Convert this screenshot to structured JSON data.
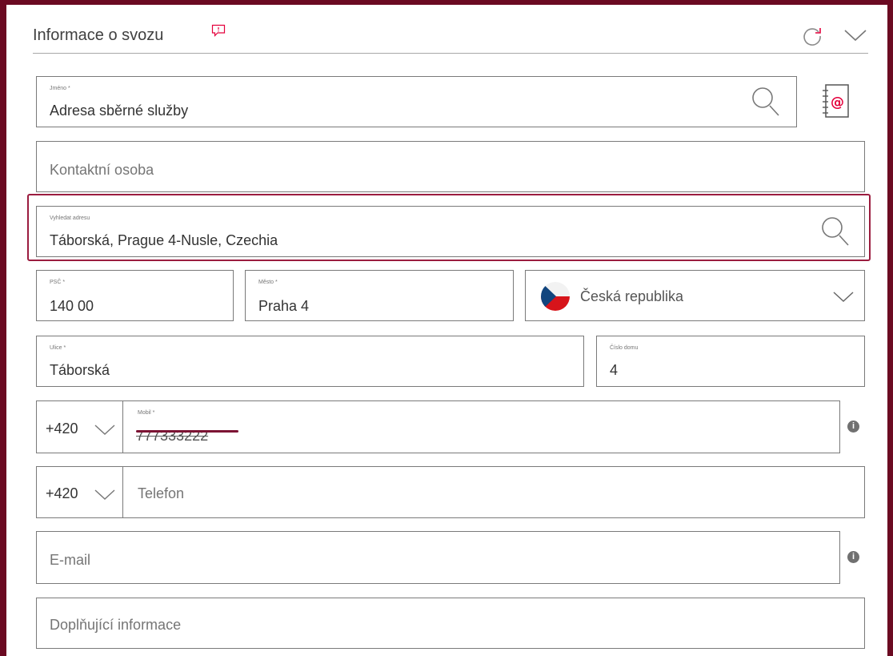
{
  "section": {
    "title": "Informace o svozu"
  },
  "icons": {
    "comment": "speech-bubble-icon",
    "refresh": "refresh-icon",
    "collapse": "chevron-down-icon",
    "search": "search-icon",
    "address_book": "address-book-icon",
    "flag": "czech-flag-icon",
    "info": "info-icon"
  },
  "fields": {
    "name": {
      "label": "Jméno *",
      "value": "Adresa sběrné služby"
    },
    "contact_person": {
      "placeholder": "Kontaktní osoba"
    },
    "address_search": {
      "label": "Vyhledat adresu",
      "value": "Táborská, Prague 4-Nusle, Czechia"
    },
    "postal_code": {
      "label": "PSČ *",
      "value": "140 00"
    },
    "city": {
      "label": "Město *",
      "value": "Praha 4"
    },
    "country": {
      "value": "Česká republika"
    },
    "street": {
      "label": "Ulice *",
      "value": "Táborská"
    },
    "house_number": {
      "label": "Číslo domu",
      "value": "4"
    },
    "mobile": {
      "prefix": "+420",
      "label": "Mobil *",
      "value": "777333222"
    },
    "phone": {
      "prefix": "+420",
      "placeholder": "Telefon"
    },
    "email": {
      "placeholder": "E-mail"
    },
    "additional_info": {
      "placeholder": "Doplňující informace"
    }
  },
  "info_badge": "i",
  "colors": {
    "frame": "#6b0a22",
    "accent": "#9b1c3f",
    "brand_pink": "#e4003c",
    "border": "#7a7a7a"
  }
}
